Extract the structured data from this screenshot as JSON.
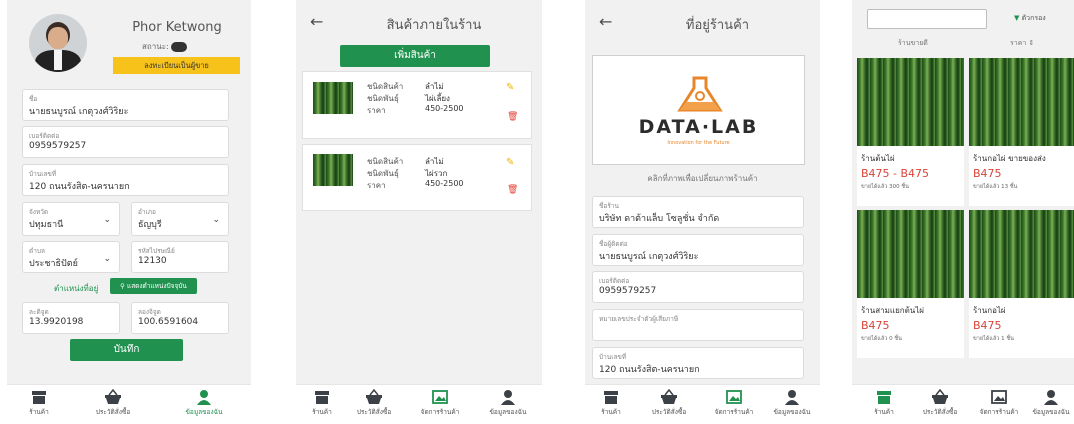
{
  "screen1": {
    "name": "Phor Ketwong",
    "status_label": "สถานะ:",
    "register_button": "ลงทะเบียนเป็นผู้ขาย",
    "fields": {
      "name": {
        "label": "ชื่อ",
        "value": "นายธนบูรณ์ เกตุวงศ์วิริยะ"
      },
      "phone": {
        "label": "เบอร์ติดต่อ",
        "value": "0959579257"
      },
      "address": {
        "label": "บ้านเลขที่",
        "value": "120 ถนนรังสิต-นครนายก"
      },
      "province": {
        "label": "จังหวัด",
        "value": "ปทุมธานี"
      },
      "district": {
        "label": "อำเภอ",
        "value": "ธัญบุรี"
      },
      "subdistrict": {
        "label": "ตำบล",
        "value": "ประชาธิปัตย์"
      },
      "postcode": {
        "label": "รหัสไปรษณีย์",
        "value": "12130"
      },
      "latitude": {
        "label": "ละติจูด",
        "value": "13.9920198"
      },
      "longitude": {
        "label": "ลองจิจูด",
        "value": "100.6591604"
      }
    },
    "location_label": "ตำแหน่งที่อยู่",
    "show_location_button": "แสดงตำแหน่งปัจจุบัน",
    "save_button": "บันทึก"
  },
  "screen2": {
    "title": "สินค้าภายในร้าน",
    "add_button": "เพิ่มสินค้า",
    "products": [
      {
        "type_label": "ชนิดสินค้า",
        "type_value": "ลำไม่",
        "variety_label": "ชนิดพันธุ์",
        "variety_value": "ไผ่เลี้ยง",
        "price_label": "ราคา",
        "price_value": "450-2500"
      },
      {
        "type_label": "ชนิดสินค้า",
        "type_value": "ลำไม่",
        "variety_label": "ชนิดพันธุ์",
        "variety_value": "ไผ่รวก",
        "price_label": "ราคา",
        "price_value": "450-2500"
      }
    ]
  },
  "screen3": {
    "title": "ที่อยู่ร้านค้า",
    "logo_text": "DATA·LAB",
    "logo_tagline": "Innovation for the Future",
    "logo_hint": "คลิกที่ภาพเพื่อเปลี่ยนภาพร้านค้า",
    "fields": {
      "shop_name": {
        "label": "ชื่อร้าน",
        "value": "บริษัท ดาต้าแล็บ โซลูชั่น จำกัด"
      },
      "contact": {
        "label": "ชื่อผู้ติดต่อ",
        "value": "นายธนบูรณ์ เกตุวงศ์วิริยะ"
      },
      "phone": {
        "label": "เบอร์ติดต่อ",
        "value": "0959579257"
      },
      "tax_id": {
        "label": "หมายเลขประจำตัวผู้เสียภาษี",
        "value": ""
      },
      "address": {
        "label": "บ้านเลขที่",
        "value": "120 ถนนรังสิต-นครนายก"
      }
    }
  },
  "screen4": {
    "filter_label": "ตัวกรอง",
    "sort_tabs": [
      "ร้านขายดี",
      "ราคา"
    ],
    "shops": [
      {
        "name": "ร้านต้นไผ่",
        "price": "B475 - B475",
        "sold": "ขายได้แล้ว 300 ชิ้น"
      },
      {
        "name": "ร้านกอไผ่ ขายของส่ง",
        "price": "B475",
        "sold": "ขายได้แล้ว 13 ชิ้น"
      },
      {
        "name": "ร้านสามแยกต้นไผ่",
        "price": "B475",
        "sold": "ขายได้แล้ว 0 ชิ้น"
      },
      {
        "name": "ร้านกอไผ่",
        "price": "B475",
        "sold": "ขายได้แล้ว 1 ชิ้น"
      }
    ]
  },
  "nav": {
    "shop": "ร้านค้า",
    "history": "ประวัติสั่งซื้อ",
    "manage": "จัดการร้านค้า",
    "profile": "ข้อมูลของฉัน"
  },
  "colors": {
    "green": "#219150",
    "yellow": "#f7c21a",
    "red": "#d9443b"
  }
}
